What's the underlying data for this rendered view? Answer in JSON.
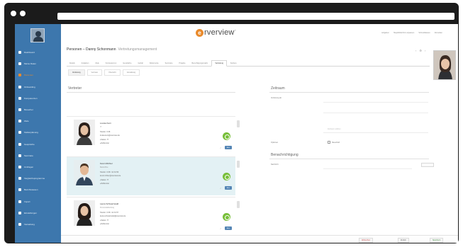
{
  "app": {
    "logo_letter": "e",
    "logo_text": "rverview",
    "logo_tm": "®",
    "brand_color": "#e98a2c",
    "sidebar_color": "#3d77ad"
  },
  "header": {
    "links": [
      "Aufgaben",
      "Hauptbildschirm anpassen",
      "Schnelldateien",
      "Abmelden"
    ]
  },
  "sidebar": {
    "items": [
      {
        "label": "Dashboard",
        "icon": "dashboard-icon",
        "active": false
      },
      {
        "label": "Meine Daten",
        "icon": "user-icon",
        "active": false
      },
      {
        "label": "Personen",
        "icon": "people-icon",
        "active": true
      },
      {
        "label": "Onboarding",
        "icon": "onboarding-icon",
        "active": false
      },
      {
        "label": "Kompetenzen",
        "icon": "star-icon",
        "active": false
      },
      {
        "label": "Bewerber",
        "icon": "applicant-icon",
        "active": false
      },
      {
        "label": "Ziele",
        "icon": "target-icon",
        "active": false
      },
      {
        "label": "Stellenplanung",
        "icon": "chart-icon",
        "active": false
      },
      {
        "label": "Gespräche",
        "icon": "chat-icon",
        "active": false
      },
      {
        "label": "Seminare",
        "icon": "seminar-icon",
        "active": false
      },
      {
        "label": "Umfragen",
        "icon": "survey-icon",
        "active": false
      },
      {
        "label": "Vergleichsprogramme",
        "icon": "compare-icon",
        "active": false
      },
      {
        "label": "Berichtswesen",
        "icon": "report-icon",
        "active": false
      },
      {
        "label": "Import",
        "icon": "import-icon",
        "active": false
      },
      {
        "label": "Einstellungen",
        "icon": "gear-icon",
        "active": false
      },
      {
        "label": "Verwaltung",
        "icon": "admin-icon",
        "active": false
      }
    ]
  },
  "page": {
    "title": "Personen – Danny Schonmann",
    "subtitle": "Vertretungsmanagement",
    "icons": [
      "‹",
      "⚙",
      "›"
    ]
  },
  "tabs": [
    "Details",
    "Aufgaben",
    "Ziele",
    "Kompetenzen",
    "Gespräche",
    "Gehalt",
    "Dokumente",
    "Seminare",
    "Projekte",
    "Berechtigungsmatrix",
    "Vertretung",
    "Karriere"
  ],
  "active_tab": 10,
  "subtabs": [
    "Vertretung",
    "Vertreter",
    "Übersicht",
    "Verwaltung"
  ],
  "active_subtab": 0,
  "left_section": {
    "title": "Vertreter"
  },
  "representatives": [
    {
      "name": "Louisa Kern",
      "role": "IT",
      "lines": [
        "Telefon: 0 68",
        "louisa.kern@overview.de"
      ],
      "bullets": [
        "Status: IT",
        "Zeitfenster"
      ],
      "highlight": false,
      "button": "Aktiv"
    },
    {
      "name": "Kevin Richter",
      "role": "Backoffice",
      "lines": [
        "Telefon: 0 68 / 12 34 56",
        "kevin.richter@overview.de"
      ],
      "bullets": [
        "Status: IT",
        "Zeitfenster"
      ],
      "highlight": true,
      "button": "Aktiv"
    },
    {
      "name": "Laura Schwarzwald",
      "role": "Personalabteilung",
      "lines": [
        "Telefon: 0 68 / 12 34 57",
        "laura.schwarzwald@overview.de"
      ],
      "bullets": [
        "Status: IT",
        "Zeitfenster"
      ],
      "highlight": false,
      "button": "Aktiv"
    }
  ],
  "right_section": {
    "title": "Zeitraum",
    "label1": "Vertretung ab",
    "hint": "Zeitraum wählen",
    "label2": "Optionen",
    "checkbox_label": "Dauerhaft",
    "title2": "Benachrichtigung",
    "label3": "Nachricht"
  },
  "footer": {
    "buttons": [
      "Abbrechen",
      "Zurück",
      "Speichern"
    ]
  }
}
